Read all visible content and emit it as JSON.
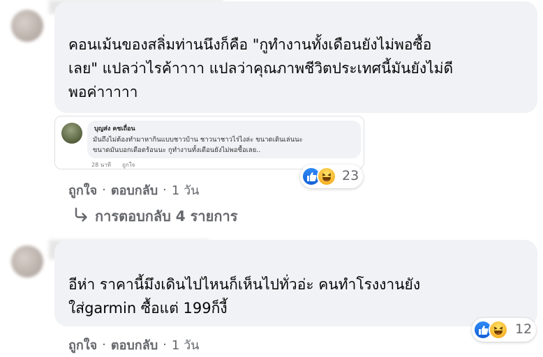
{
  "comment1": {
    "lines": [
      "คอนเม้นของสลิ่มท่านนึงก็คือ \"กูทำงานทั้งเดือนยังไม่พอซื้อ",
      "เลย\" แปลว่าไรค้าาาา แปลว่าคุณภาพชีวิตประเทศนี้มันยังไม่ดี",
      "พอค่าาาาา"
    ],
    "screenshot": {
      "name": "บุญส่ง คชเถื่อน",
      "line1": "มันถึงไม่ต้องทำมาหากินแบบชาวบ้าน ชาวนาชาวไร่ไงล่ะ ขนาดเดินเล่นนะ",
      "line2": "ขนาดมันบอกเดือดร้อนนะ กูทำงานทั้งเดือนยังไม่พอซื้อเลย..",
      "time": "28 นาที",
      "like": "ถูกใจ"
    },
    "reaction_count": "23",
    "actions": {
      "like": "ถูกใจ",
      "reply": "ตอบกลับ",
      "dot": "·",
      "time": "1 วัน"
    },
    "view_replies": "การตอบกลับ 4 รายการ"
  },
  "comment2": {
    "lines": [
      "อีห่า ราคานี้มึงเดินไปไหนก็เห็นไปทั่วอ่ะ คนทำโรงงานยัง",
      "ใส่garmin ซื้อแต่ 199ก็งี้"
    ],
    "reaction_count": "12",
    "actions": {
      "like": "ถูกใจ",
      "reply": "ตอบกลับ",
      "dot": "·",
      "time": "1 วัน"
    }
  },
  "icons": [
    "like-icon",
    "haha-icon",
    "reply-arrow-icon"
  ],
  "colors": {
    "bubble": "#f0f2f5",
    "secondary_text": "#65676b",
    "like_blue": "#1877f2",
    "haha_yellow": "#f7b125"
  }
}
